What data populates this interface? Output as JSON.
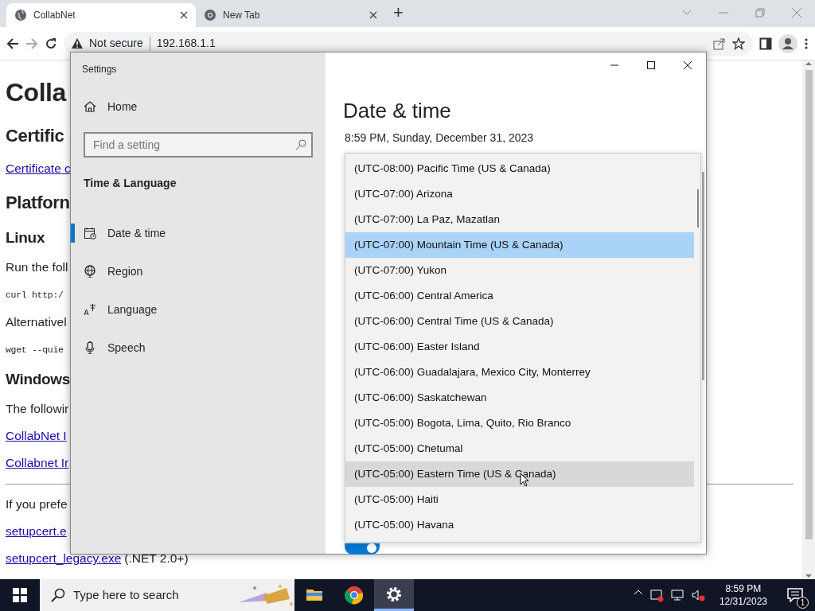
{
  "browser": {
    "tabs": [
      {
        "title": "CollabNet",
        "selected": true
      },
      {
        "title": "New Tab",
        "selected": false
      }
    ],
    "new_tab": "+",
    "security": "Not secure",
    "url": "192.168.1.1"
  },
  "page": [
    {
      "kind": "h1",
      "text": "Colla"
    },
    {
      "kind": "h2",
      "text": "Certific"
    },
    {
      "kind": "link",
      "text": "Certificate c"
    },
    {
      "kind": "h2",
      "text": "Platforn"
    },
    {
      "kind": "h3",
      "text": "Linux"
    },
    {
      "kind": "p",
      "text": "Run the foll"
    },
    {
      "kind": "code",
      "text": "curl http:/"
    },
    {
      "kind": "p",
      "text": "Alternativel"
    },
    {
      "kind": "code",
      "text": "wget --quie"
    },
    {
      "kind": "h3",
      "text": "Windows"
    },
    {
      "kind": "p",
      "text": "The followir"
    },
    {
      "kind": "link",
      "text": "CollabNet I"
    },
    {
      "kind": "link",
      "text": "Collabnet Ir"
    },
    {
      "kind": "hr"
    },
    {
      "kind": "p",
      "text": "If you prefe"
    },
    {
      "kind": "link",
      "text": "setupcert.e"
    },
    {
      "kind": "linknote",
      "text": "setupcert_legacy.exe",
      "note": "(.NET 2.0+)"
    }
  ],
  "settings": {
    "title": "Settings",
    "home": "Home",
    "search_placeholder": "Find a setting",
    "section": "Time & Language",
    "nav": [
      {
        "label": "Date & time",
        "selected": true
      },
      {
        "label": "Region",
        "selected": false
      },
      {
        "label": "Language",
        "selected": false
      },
      {
        "label": "Speech",
        "selected": false
      }
    ],
    "heading": "Date & time",
    "current": "8:59 PM, Sunday, December 31, 2023",
    "toggle": {
      "on": true
    },
    "timezones": [
      {
        "label": "(UTC-08:00) Pacific Time (US & Canada)",
        "selected": false,
        "hovered": false
      },
      {
        "label": "(UTC-07:00) Arizona",
        "selected": false,
        "hovered": false
      },
      {
        "label": "(UTC-07:00) La Paz, Mazatlan",
        "selected": false,
        "hovered": false
      },
      {
        "label": "(UTC-07:00) Mountain Time (US & Canada)",
        "selected": true,
        "hovered": false
      },
      {
        "label": "(UTC-07:00) Yukon",
        "selected": false,
        "hovered": false
      },
      {
        "label": "(UTC-06:00) Central America",
        "selected": false,
        "hovered": false
      },
      {
        "label": "(UTC-06:00) Central Time (US & Canada)",
        "selected": false,
        "hovered": false
      },
      {
        "label": "(UTC-06:00) Easter Island",
        "selected": false,
        "hovered": false
      },
      {
        "label": "(UTC-06:00) Guadalajara, Mexico City, Monterrey",
        "selected": false,
        "hovered": false
      },
      {
        "label": "(UTC-06:00) Saskatchewan",
        "selected": false,
        "hovered": false
      },
      {
        "label": "(UTC-05:00) Bogota, Lima, Quito, Rio Branco",
        "selected": false,
        "hovered": false
      },
      {
        "label": "(UTC-05:00) Chetumal",
        "selected": false,
        "hovered": false
      },
      {
        "label": "(UTC-05:00) Eastern Time (US & Canada)",
        "selected": false,
        "hovered": true
      },
      {
        "label": "(UTC-05:00) Haiti",
        "selected": false,
        "hovered": false
      },
      {
        "label": "(UTC-05:00) Havana",
        "selected": false,
        "hovered": false
      }
    ]
  },
  "taskbar": {
    "search_placeholder": "Type here to search",
    "apps": [
      {
        "active": false
      },
      {
        "active": false
      },
      {
        "active": true
      }
    ],
    "time": "8:59 PM",
    "date": "12/31/2023",
    "notifications": "1"
  }
}
